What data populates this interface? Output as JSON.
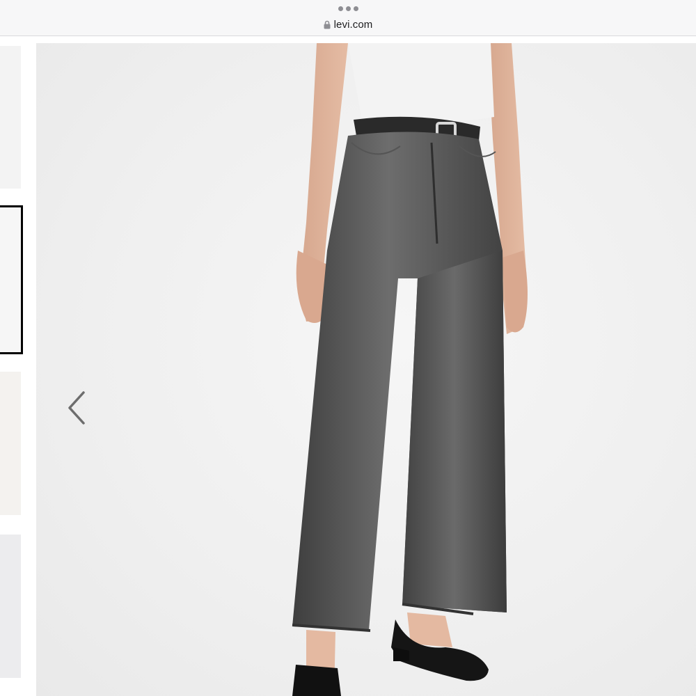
{
  "browser": {
    "url": "levi.com",
    "menu_icon": "more-dots-icon",
    "lock_icon": "lock-icon"
  },
  "gallery": {
    "selected_thumbnail": 2,
    "thumbnail_count_visible": 4,
    "prev_icon": "chevron-left-icon"
  },
  "colors": {
    "denim": "#4a4a4a",
    "background": "#efefef",
    "selected_border": "#000000"
  }
}
